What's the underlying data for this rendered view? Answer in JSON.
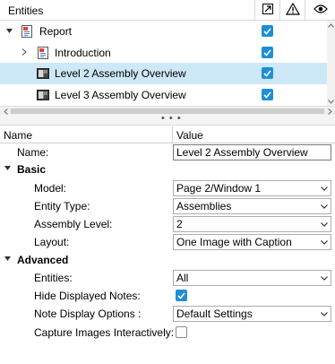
{
  "tree": {
    "title": "Entities",
    "header_icons": [
      "expand-arrow-icon",
      "warning-icon",
      "eye-icon"
    ],
    "items": [
      {
        "label": "Report",
        "icon": "report-icon",
        "expander": "expanded",
        "checked": true,
        "selected": false
      },
      {
        "label": "Introduction",
        "icon": "report-page-icon",
        "expander": "collapsed",
        "checked": true,
        "selected": false
      },
      {
        "label": "Level 2 Assembly Overview",
        "icon": "image-slide-icon",
        "expander": "none",
        "checked": true,
        "selected": true
      },
      {
        "label": "Level 3 Assembly Overview",
        "icon": "image-slide-icon",
        "expander": "none",
        "checked": true,
        "selected": false
      }
    ]
  },
  "splitter": {
    "dots": "• • •"
  },
  "properties": {
    "header": {
      "name": "Name",
      "value": "Value"
    },
    "name_row": {
      "label": "Name:",
      "value": "Level 2 Assembly Overview"
    },
    "basic": {
      "title": "Basic",
      "model": {
        "label": "Model:",
        "value": "Page 2/Window 1"
      },
      "entity_type": {
        "label": "Entity Type:",
        "value": "Assemblies"
      },
      "assembly_level": {
        "label": "Assembly Level:",
        "value": "2"
      },
      "layout": {
        "label": "Layout:",
        "value": "One Image with Caption"
      }
    },
    "advanced": {
      "title": "Advanced",
      "entities": {
        "label": "Entities:",
        "value": "All"
      },
      "hide_notes": {
        "label": "Hide Displayed Notes:",
        "checked": true
      },
      "note_display": {
        "label": "Note Display Options :",
        "value": "Default Settings"
      },
      "capture": {
        "label": "Capture Images Interactively:",
        "checked": false
      }
    }
  },
  "colors": {
    "accent": "#1e8fd6",
    "selection": "#cde8f7"
  }
}
